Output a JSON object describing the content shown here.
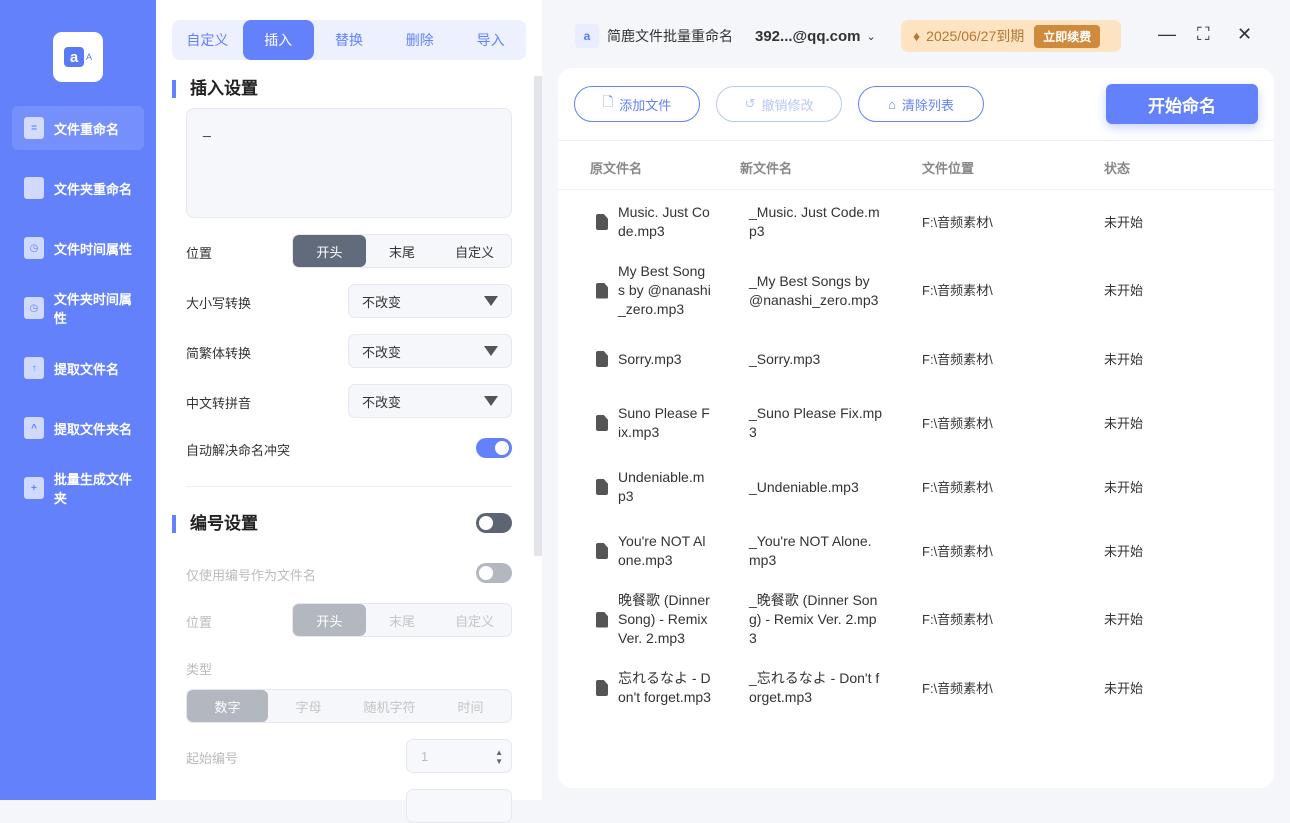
{
  "sidebar": {
    "logo_letter": "a",
    "logo_small": "A",
    "items": [
      {
        "label": "文件重命名"
      },
      {
        "label": "文件夹重命名"
      },
      {
        "label": "文件时间属性"
      },
      {
        "label": "文件夹时间属性"
      },
      {
        "label": "提取文件名"
      },
      {
        "label": "提取文件夹名"
      },
      {
        "label": "批量生成文件夹"
      }
    ]
  },
  "tabs": [
    "自定义",
    "插入",
    "替换",
    "删除",
    "导入"
  ],
  "insert": {
    "title": "插入设置",
    "text": "_",
    "position_label": "位置",
    "position_options": [
      "开头",
      "末尾",
      "自定义"
    ],
    "case_label": "大小写转换",
    "case_value": "不改变",
    "trad_label": "简繁体转换",
    "trad_value": "不改变",
    "pinyin_label": "中文转拼音",
    "pinyin_value": "不改变",
    "conflict_label": "自动解决命名冲突",
    "conflict_on": true
  },
  "numbering": {
    "title": "编号设置",
    "enabled": false,
    "only_label": "仅使用编号作为文件名",
    "position_label": "位置",
    "position_options": [
      "开头",
      "末尾",
      "自定义"
    ],
    "type_label": "类型",
    "type_options": [
      "数字",
      "字母",
      "随机字符",
      "时间"
    ],
    "start_label": "起始编号",
    "start_value": "1"
  },
  "header": {
    "app_title": "简鹿文件批量重命名",
    "account": "392...@qq.com",
    "expiry": "2025/06/27到期",
    "renew": "立即续费"
  },
  "toolbar": {
    "add": "添加文件",
    "undo": "撤销修改",
    "clear": "清除列表",
    "start": "开始命名"
  },
  "table": {
    "columns": [
      "原文件名",
      "新文件名",
      "文件位置",
      "状态"
    ],
    "rows": [
      {
        "orig": "Music. Just Code.mp3",
        "new": "_Music. Just Code.mp3",
        "loc": "F:\\音频素材\\",
        "status": "未开始"
      },
      {
        "orig": "My Best Songs by @nanashi_zero.mp3",
        "new": "_My Best Songs by @nanashi_zero.mp3",
        "loc": "F:\\音频素材\\",
        "status": "未开始"
      },
      {
        "orig": "Sorry.mp3",
        "new": "_Sorry.mp3",
        "loc": "F:\\音频素材\\",
        "status": "未开始"
      },
      {
        "orig": "Suno Please Fix.mp3",
        "new": "_Suno Please Fix.mp3",
        "loc": "F:\\音频素材\\",
        "status": "未开始"
      },
      {
        "orig": "Undeniable.mp3",
        "new": "_Undeniable.mp3",
        "loc": "F:\\音频素材\\",
        "status": "未开始"
      },
      {
        "orig": "You're NOT Alone.mp3",
        "new": "_You're NOT Alone.mp3",
        "loc": "F:\\音频素材\\",
        "status": "未开始"
      },
      {
        "orig": "晚餐歌 (Dinner Song) - Remix Ver. 2.mp3",
        "new": "_晚餐歌 (Dinner Song) - Remix Ver. 2.mp3",
        "loc": "F:\\音频素材\\",
        "status": "未开始"
      },
      {
        "orig": "忘れるなよ - Don't forget.mp3",
        "new": "_忘れるなよ - Don't forget.mp3",
        "loc": "F:\\音频素材\\",
        "status": "未开始"
      }
    ]
  }
}
